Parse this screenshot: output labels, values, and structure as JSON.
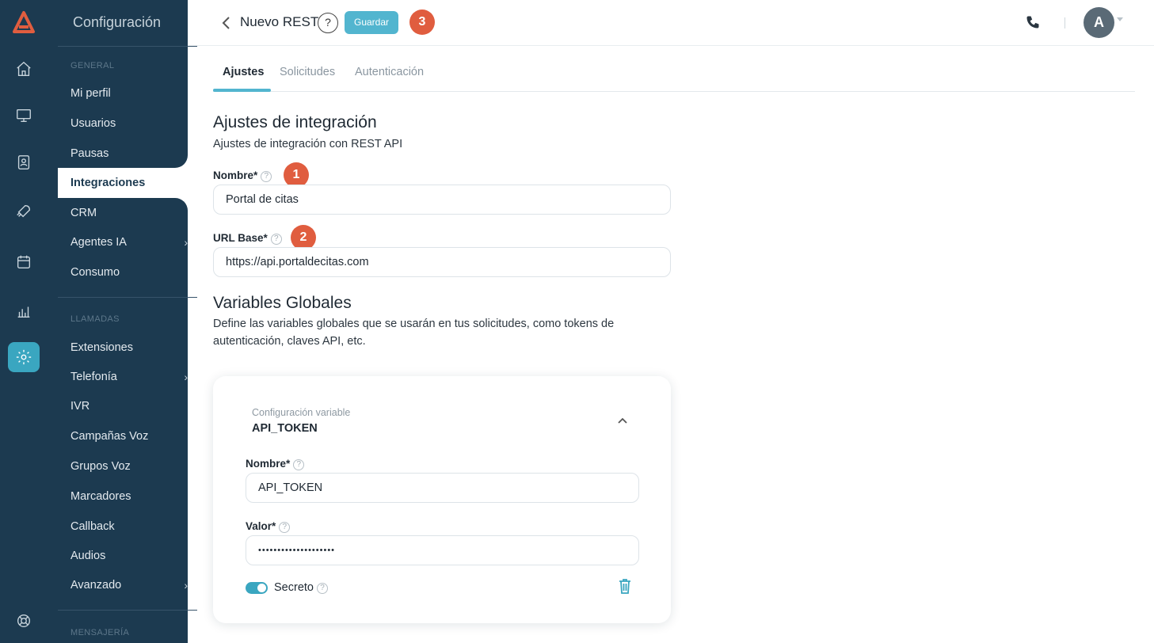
{
  "sidebar": {
    "title": "Configuración",
    "sections": {
      "general": "GENERAL",
      "llamadas": "LLAMADAS",
      "mensajeria": "MENSAJERÍA"
    },
    "items": [
      {
        "label": "Mi perfil"
      },
      {
        "label": "Usuarios"
      },
      {
        "label": "Pausas"
      },
      {
        "label": "Integraciones"
      },
      {
        "label": "CRM"
      },
      {
        "label": "Agentes IA"
      },
      {
        "label": "Consumo"
      },
      {
        "label": "Extensiones"
      },
      {
        "label": "Telefonía"
      },
      {
        "label": "IVR"
      },
      {
        "label": "Campañas Voz"
      },
      {
        "label": "Grupos Voz"
      },
      {
        "label": "Marcadores"
      },
      {
        "label": "Callback"
      },
      {
        "label": "Audios"
      },
      {
        "label": "Avanzado"
      }
    ],
    "active_item": "Integraciones",
    "rail_icons": [
      "home-icon",
      "monitor-icon",
      "contacts-icon",
      "rocket-icon",
      "calendar-icon",
      "analytics-icon",
      "gear-icon",
      "support-icon"
    ]
  },
  "header": {
    "title": "Nuevo REST",
    "help": "?",
    "save_label": "Guardar",
    "avatar_initial": "A"
  },
  "badges": {
    "one": "1",
    "two": "2",
    "three": "3"
  },
  "tabs": [
    {
      "label": "Ajustes"
    },
    {
      "label": "Solicitudes"
    },
    {
      "label": "Autenticación"
    }
  ],
  "integration": {
    "heading": "Ajustes de integración",
    "subtitle": "Ajustes de integración con REST API",
    "name_label": "Nombre*",
    "name_value": "Portal de citas",
    "url_label": "URL Base*",
    "url_value": "https://api.portaldecitas.com"
  },
  "globals": {
    "heading": "Variables Globales",
    "description": "Define las variables globales que se usarán en tus solicitudes, como tokens de autenticación, claves API, etc.",
    "card": {
      "subtitle": "Configuración variable",
      "title": "API_TOKEN",
      "name_label": "Nombre*",
      "name_value": "API_TOKEN",
      "value_label": "Valor*",
      "value_masked": "••••••••••••••••••••",
      "secret_label": "Secreto",
      "secret_on": true
    }
  },
  "colors": {
    "sidebar": "#1c3a50",
    "accent": "#52b5cf",
    "badge": "#e05d3f"
  }
}
